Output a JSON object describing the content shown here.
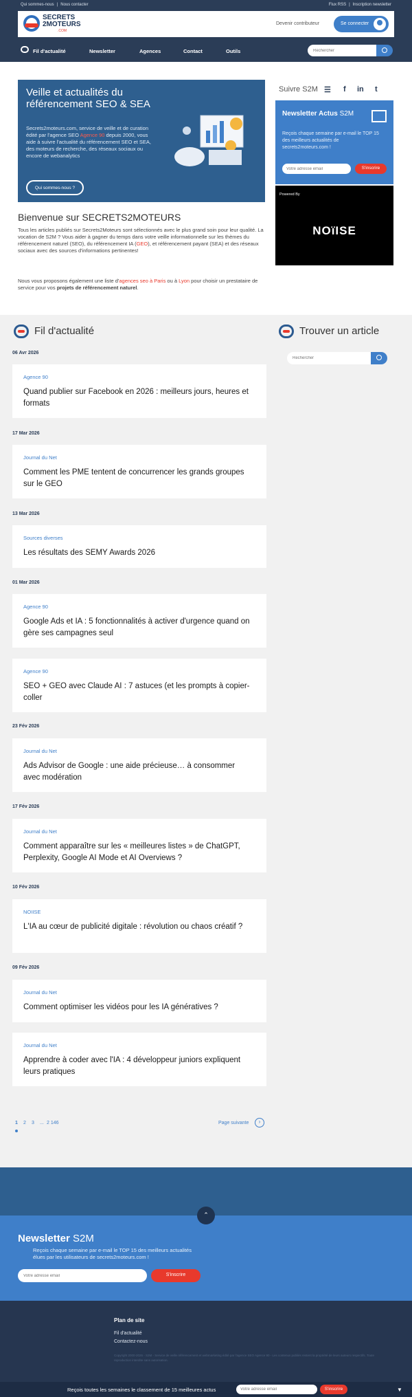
{
  "topbar": {
    "links_left": [
      "Qui sommes-nous",
      "Nous contacter"
    ],
    "links_right": [
      "Flux RSS",
      "Inscription newsletter"
    ]
  },
  "logo": {
    "line1": "SECRETS",
    "line2": "2MOTEURS",
    "line3": ".COM"
  },
  "header": {
    "contributor": "Devenir contributeur",
    "login": "Se connecter"
  },
  "nav": {
    "items": [
      "Fil d'actualité",
      "Newsletter",
      "Agences",
      "Contact",
      "Outils"
    ],
    "search_placeholder": "Rechercher"
  },
  "hero": {
    "title": "Veille et actualités du référencement SEO & SEA",
    "desc_a": "Secrets2moteurs.com, service de veille et de curation édité par l'agence SEO ",
    "desc_link": "Agence 90",
    "desc_b": " depuis 2000, vous aide à suivre l'actualité du référencement SEO et SEA, des moteurs de recherche, des réseaux sociaux ou encore de webanalytics",
    "button": "Qui sommes-nous ?"
  },
  "welcome": {
    "title": "Bienvenue sur SECRETS2MOTEURS",
    "p1_a": "Tous les articles publiés sur Secrets2Moteurs sont sélectionnés avec le plus grand soin pour leur qualité. La vocation de S2M ? Vous aider à gagner du temps dans votre veille informationnelle sur les thèmes du référencement naturel (SEO), du référencement IA (",
    "p1_link": "GEO",
    "p1_b": "), et référencement payant  (SEA) et des réseaux sociaux avec des sources d'informations pertinentes!",
    "p2_a": "Nous vous proposons également une liste d'",
    "p2_link1": "agences seo à Paris",
    "p2_mid": " ou à ",
    "p2_link2": "Lyon",
    "p2_b": " pour choisir un prestataire de service pour vos ",
    "p2_strong": "projets de référencement naturel",
    "p2_end": "."
  },
  "follow": {
    "label": "Suivre S2M",
    "icons": [
      "rss-icon",
      "facebook-icon",
      "linkedin-icon",
      "twitter-icon"
    ],
    "glyphs": [
      "☰",
      "f",
      "in",
      "t"
    ]
  },
  "newsletter_box": {
    "title": "Newsletter Actus",
    "title_b": "S2M",
    "desc": "Reçois chaque semaine par e-mail le TOP 15 des meilleurs actualités de secrets2moteurs.com !",
    "placeholder": "Votre adresse email",
    "button": "S'inscrire"
  },
  "powered": {
    "label": "Powered By",
    "brand": "NOïISE"
  },
  "feed_title": "Fil d'actualité",
  "find_title": "Trouver un article",
  "find_placeholder": "Rechercher",
  "feed": [
    {
      "date": "06 Avr 2026",
      "source": "Agence 90",
      "title": "Quand publier sur Facebook en 2026 : meilleurs jours, heures et formats"
    },
    {
      "date": "17 Mar 2026",
      "source": "Journal du Net",
      "title": "Comment les PME tentent de concurrencer les grands groupes sur le GEO"
    },
    {
      "date": "13 Mar 2026",
      "source": "Sources diverses",
      "title": "Les résultats des SEMY Awards 2026"
    },
    {
      "date": "01 Mar 2026",
      "source": "Agence 90",
      "title": "Google Ads et IA : 5 fonctionnalités à activer d'urgence quand on gère ses campagnes seul"
    },
    {
      "date": "",
      "source": "Agence 90",
      "title": "SEO + GEO avec Claude AI : 7 astuces (et les prompts à copier-coller"
    },
    {
      "date": "23 Fév 2026",
      "source": "Journal du Net",
      "title": "Ads Advisor de Google : une aide précieuse… à consommer avec modération"
    },
    {
      "date": "17 Fév 2026",
      "source": "Journal du Net",
      "title": "Comment apparaître sur les « meilleures listes » de ChatGPT, Perplexity, Google AI Mode et AI Overviews ?"
    },
    {
      "date": "10 Fév 2026",
      "source": "NOïISE",
      "title": "L'IA au cœur de publicité digitale : révolution ou chaos créatif ?"
    },
    {
      "date": "09 Fév 2026",
      "source": "Journal du Net",
      "title": "Comment optimiser les vidéos pour les IA génératives ?"
    },
    {
      "date": "",
      "source": "Journal du Net",
      "title": "Apprendre à coder avec l'IA : 4 développeur juniors expliquent leurs pratiques"
    }
  ],
  "pager": {
    "pages": [
      "1",
      "2",
      "3",
      "...",
      "2 146"
    ],
    "next": "Page suivante"
  },
  "bottom_newsletter": {
    "title": "Newsletter",
    "title_b": "S2M",
    "desc": "Reçois chaque semaine par e-mail le TOP 15 des meilleurs actualités élues par les utilisateurs de secrets2moteurs.com !",
    "placeholder": "Votre adresse email",
    "button": "S'inscrire"
  },
  "footer": {
    "heading": "Plan de site",
    "links": [
      "Fil d'actualité",
      "Contactez-nous"
    ],
    "copyright": "Copyright 2000-2026 - S2M - Service de veille référencement et webmarketing édité par l'agence SEO Agence 90 - Les contenus publiés restent la propriété de leurs auteurs respectifs. Toute reproduction interdite sans autorisation."
  },
  "sticky": {
    "text": "Reçois toutes les semaines le classement de 15 meilleures actus",
    "placeholder": "Votre adresse email",
    "button": "S'inscrire"
  }
}
